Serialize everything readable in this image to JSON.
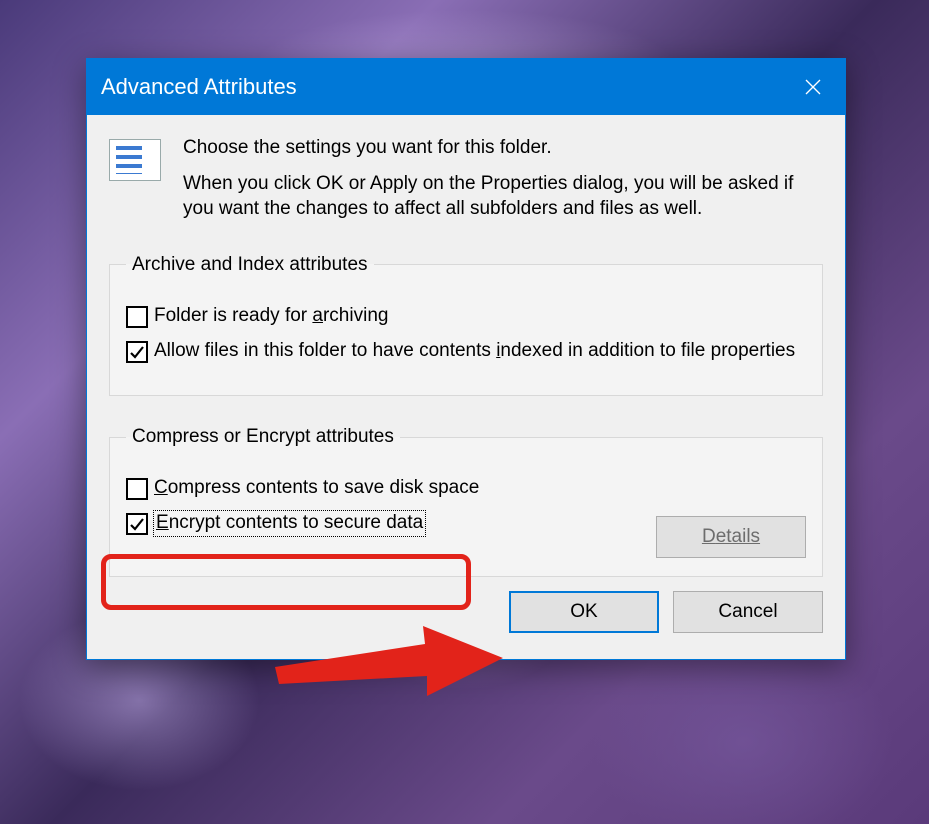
{
  "dialog": {
    "title": "Advanced Attributes",
    "intro": {
      "line1": "Choose the settings you want for this folder.",
      "line2": "When you click OK or Apply on the Properties dialog, you will be asked if you want the changes to affect all subfolders and files as well."
    },
    "group_archive": {
      "legend": "Archive and Index attributes",
      "archive_label_pre": "Folder is ready for ",
      "archive_label_u": "a",
      "archive_label_post": "rchiving",
      "archive_checked": false,
      "index_label_pre": "Allow files in this folder to have contents ",
      "index_label_u": "i",
      "index_label_post": "ndexed in addition to file properties",
      "index_checked": true
    },
    "group_compress": {
      "legend": "Compress or Encrypt attributes",
      "compress_label_u": "C",
      "compress_label_post": "ompress contents to save disk space",
      "compress_checked": false,
      "encrypt_label_u": "E",
      "encrypt_label_post": "ncrypt contents to secure data",
      "encrypt_checked": true,
      "details_label_u": "D",
      "details_label_post": "etails"
    },
    "buttons": {
      "ok": "OK",
      "cancel": "Cancel"
    }
  }
}
